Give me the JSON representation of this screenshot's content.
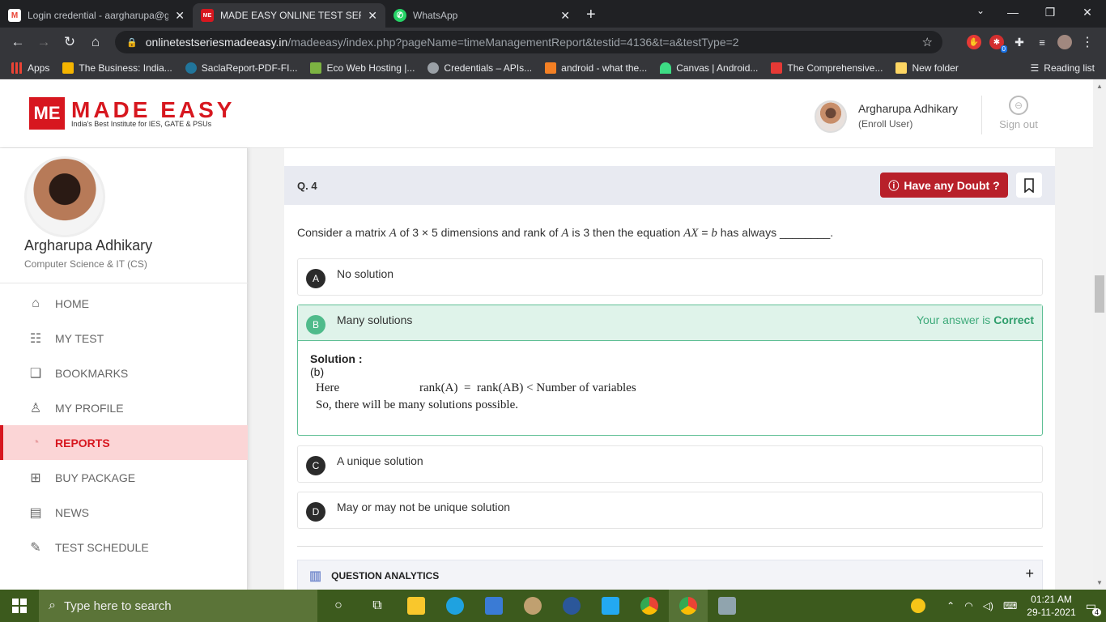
{
  "browser": {
    "tabs": [
      {
        "title": "Login credential - aargharupa@g",
        "icon": "gmail-icon",
        "color": "#ea4335",
        "glyph": "M"
      },
      {
        "title": "MADE EASY ONLINE TEST SERIES",
        "icon": "made-easy-icon",
        "color": "#d7171f",
        "glyph": "ME"
      },
      {
        "title": "WhatsApp",
        "icon": "whatsapp-icon",
        "color": "#25d366",
        "glyph": "✆"
      }
    ],
    "new_tab": "+",
    "url_host": "onlinetestseriesmadeeasy.in",
    "url_path": "/madeeasy/index.php?pageName=timeManagementReport&testid=4136&t=a&testType=2",
    "ext_badge": "0",
    "bookmarks": [
      {
        "label": "Apps",
        "color": "#ea4335"
      },
      {
        "label": "The Business: India...",
        "color": "#f4b400"
      },
      {
        "label": "SaclaReport-PDF-FI...",
        "color": "#21759b"
      },
      {
        "label": "Eco Web Hosting |...",
        "color": "#7cb342"
      },
      {
        "label": "Credentials – APIs...",
        "color": "#9aa0a6"
      },
      {
        "label": "android - what the...",
        "color": "#f48024"
      },
      {
        "label": "Canvas | Android...",
        "color": "#3ddc84"
      },
      {
        "label": "The Comprehensive...",
        "color": "#e53935"
      },
      {
        "label": "New folder",
        "color": "#fdd663"
      }
    ],
    "reading_list": "Reading list"
  },
  "site": {
    "logo_mark": "ME",
    "logo_name": "MADE EASY",
    "logo_tagline": "India's Best Institute for IES, GATE & PSUs",
    "user_name": "Argharupa Adhikary",
    "user_role": "(Enroll User)",
    "signout": "Sign out"
  },
  "sidebar": {
    "name": "Argharupa Adhikary",
    "dept": "Computer Science & IT (CS)",
    "items": [
      {
        "label": "HOME",
        "icon": "home-icon",
        "glyph": "⌂"
      },
      {
        "label": "MY TEST",
        "icon": "test-list-icon",
        "glyph": "☷"
      },
      {
        "label": "BOOKMARKS",
        "icon": "bookmark-icon",
        "glyph": "❑"
      },
      {
        "label": "MY PROFILE",
        "icon": "profile-icon",
        "glyph": "♙"
      },
      {
        "label": "REPORTS",
        "icon": "pie-chart-icon",
        "glyph": "◔"
      },
      {
        "label": "BUY PACKAGE",
        "icon": "cart-icon",
        "glyph": "⊞"
      },
      {
        "label": "NEWS",
        "icon": "news-icon",
        "glyph": "▤"
      },
      {
        "label": "TEST SCHEDULE",
        "icon": "schedule-icon",
        "glyph": "✎"
      }
    ]
  },
  "question": {
    "number": "Q. 4",
    "doubt_label": "Have any Doubt ?",
    "text_before": "Consider a matrix ",
    "var_a": "A",
    "text_mid1": " of 3 × 5 dimensions and rank of ",
    "var_a2": "A",
    "text_mid2": " is 3 then the equation ",
    "var_ax": "AX",
    "text_eq": " = ",
    "var_b": "b",
    "text_after": " has always ________.",
    "options": [
      {
        "letter": "A",
        "text": "No solution"
      },
      {
        "letter": "B",
        "text": "Many solutions"
      },
      {
        "letter": "C",
        "text": "A unique solution"
      },
      {
        "letter": "D",
        "text": "May or may not be unique solution"
      }
    ],
    "verdict_prefix": "Your answer is ",
    "verdict_word": "Correct",
    "solution_heading": "Solution :",
    "solution_answer": "(b)",
    "solution_line1_left": "Here",
    "solution_line1_right": "rank(A)  =  rank(AB) < Number of variables",
    "solution_line2": "So, there will be many solutions possible.",
    "analytics_label": "QUESTION ANALYTICS",
    "analytics_toggle": "+"
  },
  "taskbar": {
    "search_placeholder": "Type here to search",
    "time": "01:21 AM",
    "date": "29-11-2021",
    "notif_count": "4"
  }
}
